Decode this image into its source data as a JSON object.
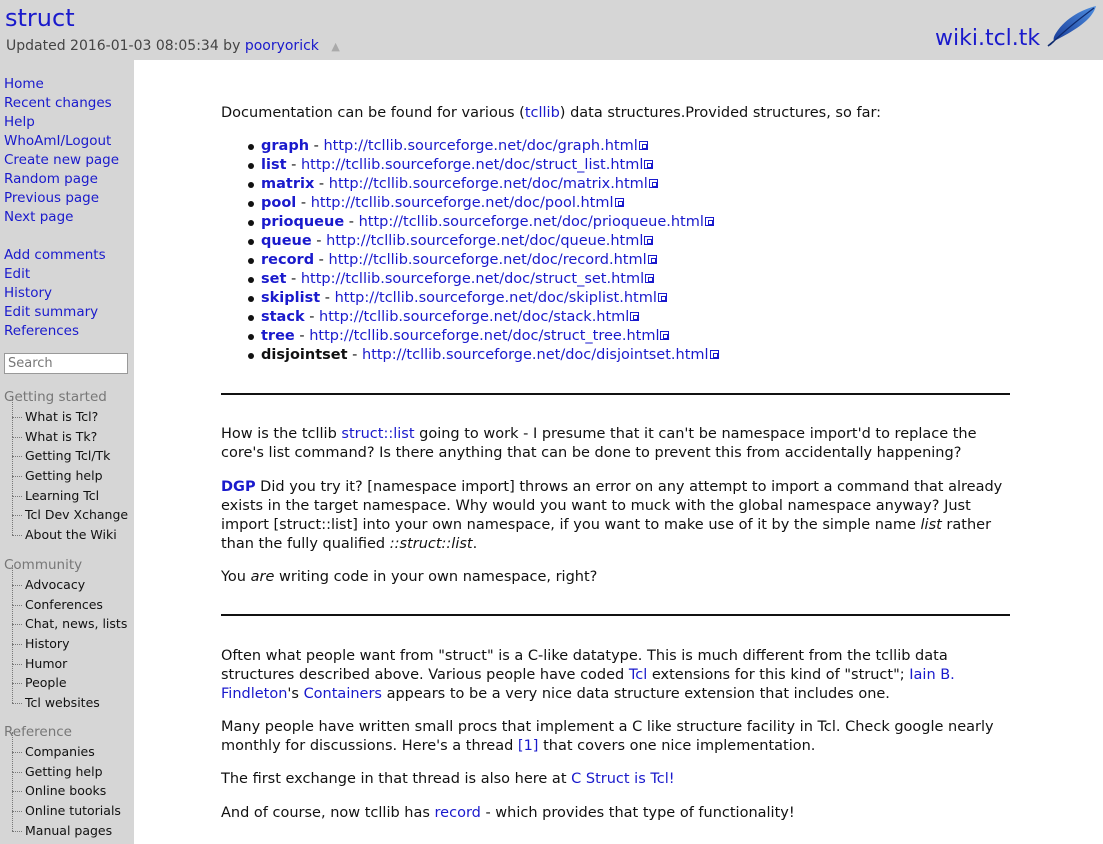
{
  "header": {
    "title": "struct",
    "updated_prefix": "Updated 2016-01-03 08:05:34 by",
    "updated_user": "pooryorick",
    "triangle": "▲",
    "site": "wiki.tcl.tk"
  },
  "sidebar": {
    "nav": [
      "Home",
      "Recent changes",
      "Help"
    ],
    "whoami": "WhoAmI",
    "logout": "Logout",
    "nav2": [
      "Create new page",
      "Random page",
      "Previous page",
      "Next page"
    ],
    "actions": [
      "Add comments",
      "Edit",
      "History",
      "Edit summary",
      "References"
    ],
    "search_placeholder": "Search",
    "sections": [
      {
        "heading": "Getting started",
        "items": [
          "What is Tcl?",
          "What is Tk?",
          "Getting Tcl/Tk",
          "Getting help",
          "Learning Tcl",
          "Tcl Dev Xchange",
          "About the Wiki"
        ]
      },
      {
        "heading": "Community",
        "items": [
          "Advocacy",
          "Conferences",
          "Chat, news, lists",
          "History",
          "Humor",
          "People",
          "Tcl websites"
        ]
      },
      {
        "heading": "Reference",
        "items": [
          "Companies",
          "Getting help",
          "Online books",
          "Online tutorials",
          "Manual pages"
        ]
      }
    ]
  },
  "content": {
    "intro_a": "Documentation can be found for various (",
    "intro_link": "tcllib",
    "intro_b": ") data structures.Provided structures, so far:",
    "structures": [
      {
        "name": "graph",
        "url": "http://tcllib.sourceforge.net/doc/graph.html"
      },
      {
        "name": "list",
        "url": "http://tcllib.sourceforge.net/doc/struct_list.html"
      },
      {
        "name": "matrix",
        "url": "http://tcllib.sourceforge.net/doc/matrix.html"
      },
      {
        "name": "pool",
        "url": "http://tcllib.sourceforge.net/doc/pool.html"
      },
      {
        "name": "prioqueue",
        "url": "http://tcllib.sourceforge.net/doc/prioqueue.html"
      },
      {
        "name": "queue",
        "url": "http://tcllib.sourceforge.net/doc/queue.html"
      },
      {
        "name": "record",
        "url": "http://tcllib.sourceforge.net/doc/record.html"
      },
      {
        "name": "set",
        "url": "http://tcllib.sourceforge.net/doc/struct_set.html"
      },
      {
        "name": "skiplist",
        "url": "http://tcllib.sourceforge.net/doc/skiplist.html"
      },
      {
        "name": "stack",
        "url": "http://tcllib.sourceforge.net/doc/stack.html"
      },
      {
        "name": "tree",
        "url": "http://tcllib.sourceforge.net/doc/struct_tree.html"
      },
      {
        "name": "disjointset",
        "url": "http://tcllib.sourceforge.net/doc/disjointset.html"
      }
    ],
    "q_a": "How is the tcllib ",
    "q_link": "struct::list",
    "q_b": " going to work - I presume that it can't be namespace import'd to replace the core's list command? Is there anything that can be done to prevent this from accidentally happening?",
    "dgp_author": "DGP",
    "dgp_a": " Did you try it? [namespace import] throws an error on any attempt to import a command that already exists in the target namespace. Why would you want to muck with the global namespace anyway? Just import [struct::list] into your own namespace, if you want to make use of it by the simple name ",
    "dgp_em1": "list",
    "dgp_b": " rather than the fully qualified ",
    "dgp_em2": "::struct::list",
    "dgp_c": ".",
    "you_a": "You ",
    "you_em": "are",
    "you_b": " writing code in your own namespace, right?",
    "often_a": "Often what people want from \"struct\" is a C-like datatype. This is much different from the tcllib data structures described above. Various people have coded ",
    "often_tcl": "Tcl",
    "often_b": " extensions for this kind of \"struct\"; ",
    "often_author": "Iain B. Findleton",
    "often_c": "'s ",
    "often_containers": "Containers",
    "often_d": " appears to be a very nice data structure extension that includes one.",
    "many_a": "Many people have written small procs that implement a C like structure facility in Tcl. Check google nearly monthly for discussions. Here's a thread ",
    "many_ref": "[1]",
    "many_b": " that covers one nice implementation.",
    "first_a": "The first exchange in that thread is also here at ",
    "first_link": "C Struct is Tcl!",
    "andof_a": "And of course, now tcllib has ",
    "andof_link": "record",
    "andof_b": " - which provides that type of functionality!"
  }
}
